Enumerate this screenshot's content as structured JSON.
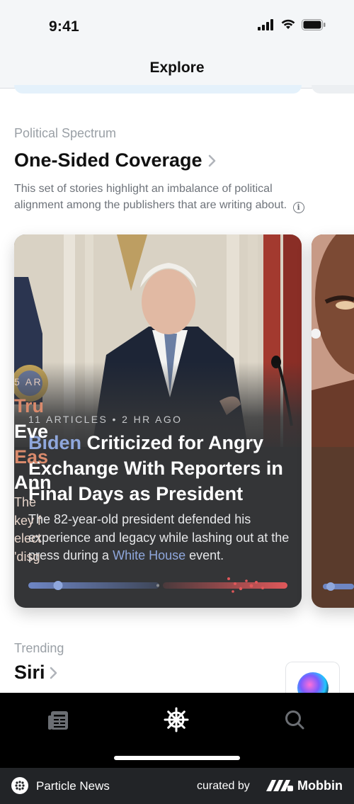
{
  "status_bar": {
    "time": "9:41"
  },
  "nav": {
    "title": "Explore"
  },
  "section": {
    "eyebrow": "Political Spectrum",
    "title": "One-Sided Coverage",
    "description": "This set of stories highlight an imbalance of political alignment among the publishers that are writing about."
  },
  "card": {
    "meta": "11 ARTICLES • 2 HR AGO",
    "headline_accent": "Biden",
    "headline_rest": " Criticized for Angry Exchange With Reporters in Final Days as President",
    "summary_before": "The 82-year-old president defended his experience and legacy while lashing out at the press during a ",
    "summary_link": "White House",
    "summary_after": " event.",
    "accent_color": "#8fa7dc",
    "spectrum_left_color": "#6e86c4",
    "spectrum_right_color": "#e0585a"
  },
  "peek_card": {
    "meta": "5 AR",
    "headline_lines": [
      "Tru",
      "Eve",
      "Eas",
      "Ann"
    ],
    "summary_lines": [
      "The",
      "key f",
      "elect",
      "'disg"
    ]
  },
  "trending": {
    "eyebrow": "Trending",
    "title": "Siri"
  },
  "tabbar": {
    "items": [
      {
        "name": "news",
        "icon": "newspaper-icon",
        "active": false
      },
      {
        "name": "explore",
        "icon": "ship-wheel-icon",
        "active": true
      },
      {
        "name": "search",
        "icon": "search-icon",
        "active": false
      }
    ]
  },
  "footer": {
    "app_name": "Particle News",
    "curated_label": "curated by",
    "brand": "Mobbin"
  }
}
